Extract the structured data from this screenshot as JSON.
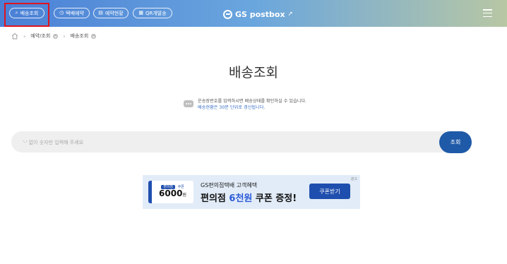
{
  "header": {
    "nav": [
      {
        "label": "배송조회",
        "icon": "search-icon"
      },
      {
        "label": "택배예약",
        "icon": "clock-icon"
      },
      {
        "label": "예약현황",
        "icon": "document-icon"
      },
      {
        "label": "QR개발송",
        "icon": "qr-icon"
      }
    ],
    "logo_text": "GS postbox",
    "brand_colors": {
      "gradient_start": "#4a7fd6",
      "gradient_end": "#b8c7a4",
      "highlight": "#e0141e"
    }
  },
  "breadcrumb": {
    "items": [
      "예약/조회",
      "배송조회"
    ]
  },
  "page_title": "배송조회",
  "info": {
    "line1": "운송장번호를 입력하시면 배송상태를 확인하실 수 있습니다.",
    "line2": "배송현황은 30분 단위로 갱신됩니다."
  },
  "search": {
    "placeholder": "'-' 없이 숫자만 입력해 주세요",
    "value": "",
    "button_label": "조회",
    "button_color": "#1f5aa8"
  },
  "banner": {
    "ad_label": "광고",
    "coupon_tag": "편의점",
    "coupon_kind": "쿠폰",
    "coupon_amount": "6000",
    "coupon_unit": "원",
    "line1": "GS편의점택배 고객혜택",
    "line2_pre": "편의점 ",
    "line2_accent": "6천원",
    "line2_post": " 쿠폰 증정!",
    "button_label": "쿠폰받기"
  }
}
